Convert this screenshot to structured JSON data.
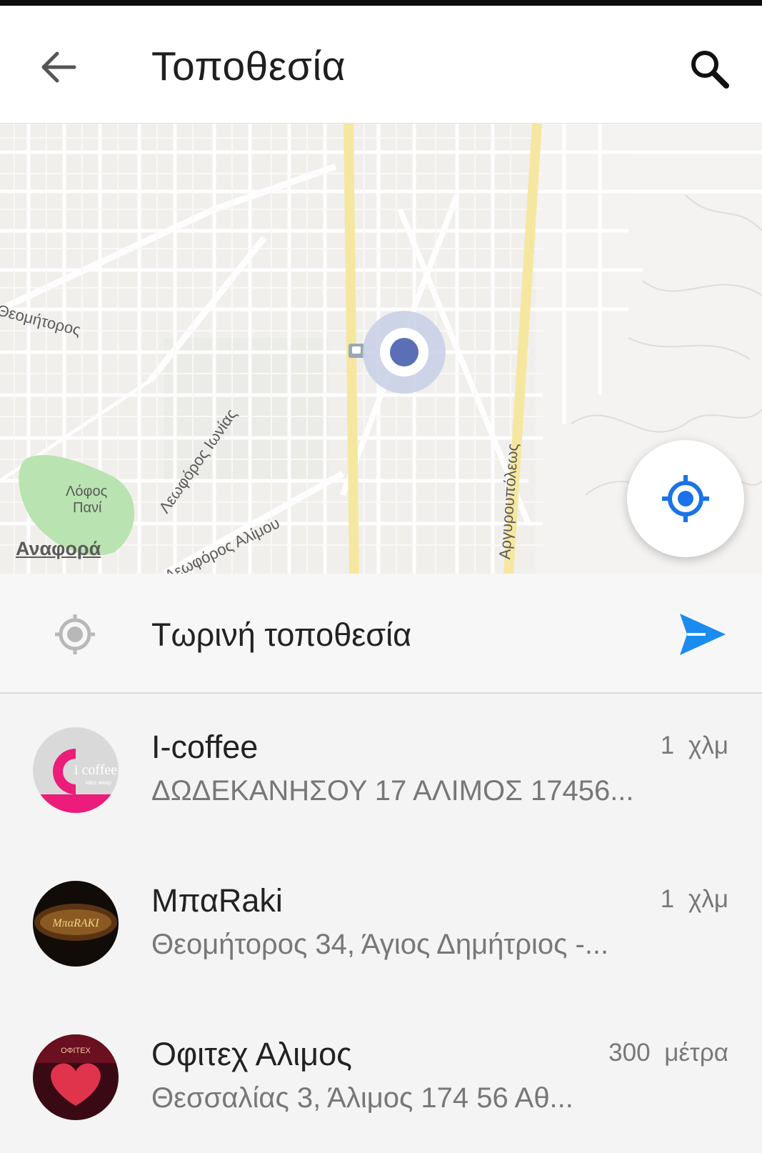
{
  "header": {
    "title": "Τοποθεσία",
    "back_icon": "arrow-left-icon",
    "search_icon": "search-icon"
  },
  "map": {
    "labels": {
      "theomitoros": "Θεομήτορος",
      "ionias": "Λεωφόρος Ιωνίας",
      "argyroupoleos": "Αργυρουπόλεως",
      "alimou": "Λεωφόρος Αλίμου",
      "lofos_line1": "Λόφος",
      "lofos_line2": "Πανί"
    },
    "report_link": "Αναφορά",
    "locate_icon": "my-location-icon",
    "colors": {
      "accent": "#1a73e8",
      "user_dot": "#5b6fb6",
      "major_road": "#f6e7a0",
      "park": "#b9e3b0"
    }
  },
  "current_location": {
    "label": "Τωρινή τοποθεσία",
    "send_icon": "send-icon"
  },
  "places": [
    {
      "name": "I-coffee",
      "address": "ΔΩΔΕΚΑΝΗΣΟΥ 17 ΑΛΙΜΟΣ 17456...",
      "distance": "1 χλμ",
      "avatar_text": "i coffee",
      "avatar_subtext": "take away"
    },
    {
      "name": "ΜπαRaki",
      "address": "Θεομήτορος 34, Άγιος Δημήτριος -...",
      "distance": "1 χλμ",
      "avatar_text": "ΜπαRAKI"
    },
    {
      "name": "Οφιτεχ Αλιμος",
      "address": "Θεσσαλίας 3, Άλιμος 174 56 Αθ...",
      "distance": "300 μέτρα",
      "avatar_text": "ΟΦΙΤΕΧ"
    }
  ]
}
